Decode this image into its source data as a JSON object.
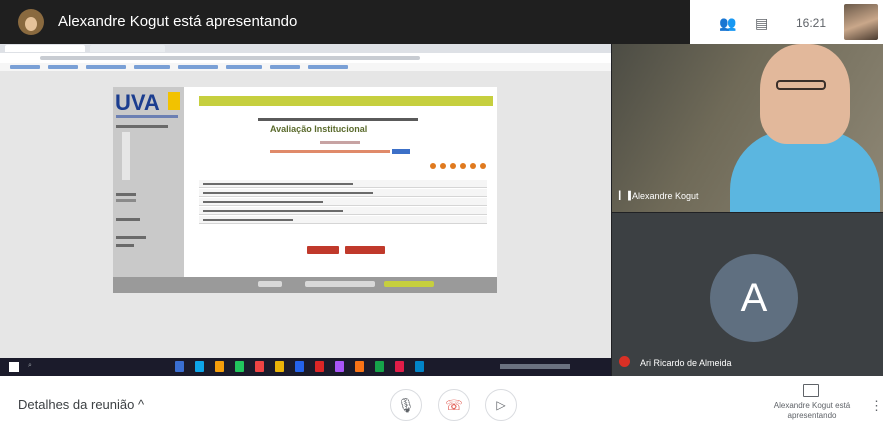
{
  "topbar": {
    "presenting_text": "Alexandre Kogut está apresentando",
    "time": "16:21"
  },
  "shared_screen": {
    "page_title": "Avaliação Institucional"
  },
  "tiles": {
    "presenter_name": "Alexandre Kogut",
    "participant_initial": "A",
    "participant_name": "Ari Ricardo de Almeida"
  },
  "bottombar": {
    "meeting_details": "Detalhes da reunião",
    "present_label": "Alexandre Kogut está apresentando"
  },
  "icons": {
    "people": "people-icon",
    "chat": "chat-icon",
    "mic": "mic-icon",
    "hangup": "hangup-icon",
    "camera": "camera-icon",
    "more": "more-icon"
  }
}
